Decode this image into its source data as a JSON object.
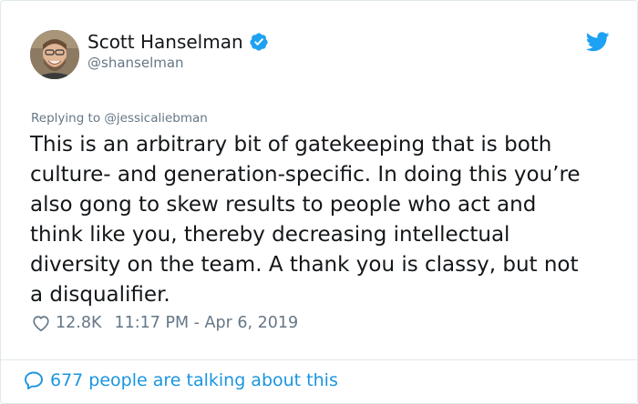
{
  "author": {
    "name": "Scott Hanselman",
    "handle": "@shanselman",
    "verified_icon": "verified-badge-icon"
  },
  "platform_icon": "twitter-bird-icon",
  "reply": {
    "prefix": "Replying to ",
    "to": "@jessicaliebman"
  },
  "tweet": {
    "text": "This is an arbitrary bit of gatekeeping that is both\nculture- and generation-specific. In doing this you’re\nalso gong to skew results to people who act and\nthink like you, thereby decreasing intellectual\ndiversity on the team. A thank you is classy, but not\na disqualifier.",
    "likes": "12.8K",
    "timestamp": "11:17 PM - Apr 6, 2019"
  },
  "footer": {
    "talking": "677 people are talking about this"
  },
  "colors": {
    "accent": "#1b95e0",
    "muted": "#657786",
    "text": "#14171a",
    "border": "#e1e8ed"
  }
}
